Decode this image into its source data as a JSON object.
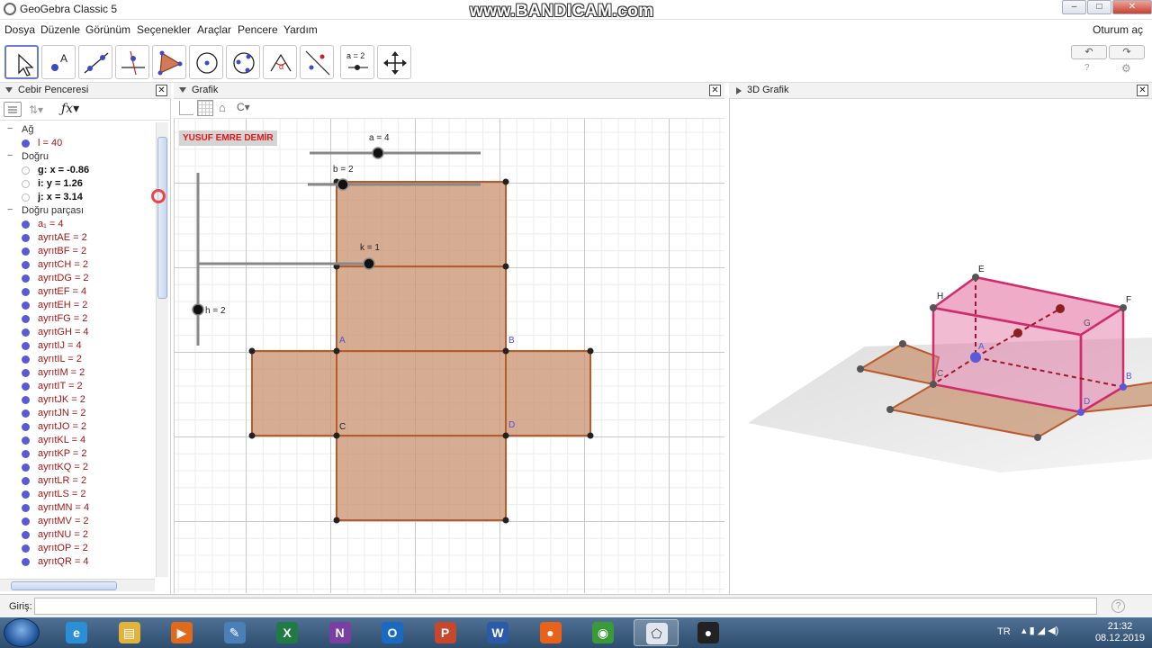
{
  "window": {
    "title": "GeoGebra Classic 5",
    "watermark": "www.BANDICAM.com",
    "buttons": {
      "minimize": "–",
      "maximize": "□",
      "close": "✕"
    }
  },
  "menu": {
    "items": [
      "Dosya",
      "Düzenle",
      "Görünüm",
      "Seçenekler",
      "Araçlar",
      "Pencere",
      "Yardım"
    ],
    "login": "Oturum aç"
  },
  "toolbar": {
    "tools": [
      {
        "name": "move-tool-icon"
      },
      {
        "name": "point-tool-icon"
      },
      {
        "name": "line-tool-icon"
      },
      {
        "name": "perpendicular-tool-icon"
      },
      {
        "name": "polygon-tool-icon"
      },
      {
        "name": "circle-tool-icon"
      },
      {
        "name": "ellipse-tool-icon"
      },
      {
        "name": "angle-tool-icon"
      },
      {
        "name": "reflect-tool-icon"
      },
      {
        "name": "slider-tool-icon",
        "label": "a = 2"
      },
      {
        "name": "move-view-tool-icon"
      }
    ],
    "undo": "↶",
    "redo": "↷",
    "help": "?",
    "settings": "⚙"
  },
  "algebra": {
    "title": "Cebir Penceresi",
    "categories": [
      {
        "label": "Ağ",
        "items": [
          {
            "text": "l = 40",
            "style": "red",
            "dot": "filled"
          }
        ]
      },
      {
        "label": "Doğru",
        "items": [
          {
            "text": "g: x = -0.86",
            "style": "blk",
            "dot": "hollow"
          },
          {
            "text": "i: y = 1.26",
            "style": "blk",
            "dot": "hollow"
          },
          {
            "text": "j: x = 3.14",
            "style": "blk",
            "dot": "hollow"
          }
        ]
      },
      {
        "label": "Doğru parçası",
        "items": [
          {
            "text": "a₁ = 4",
            "style": "red",
            "dot": "filled"
          },
          {
            "text": "ayrıtAE = 2",
            "style": "red",
            "dot": "filled"
          },
          {
            "text": "ayrıtBF = 2",
            "style": "red",
            "dot": "filled"
          },
          {
            "text": "ayrıtCH = 2",
            "style": "red",
            "dot": "filled"
          },
          {
            "text": "ayrıtDG = 2",
            "style": "red",
            "dot": "filled"
          },
          {
            "text": "ayrıtEF = 4",
            "style": "red",
            "dot": "filled"
          },
          {
            "text": "ayrıtEH = 2",
            "style": "red",
            "dot": "filled"
          },
          {
            "text": "ayrıtFG = 2",
            "style": "red",
            "dot": "filled"
          },
          {
            "text": "ayrıtGH = 4",
            "style": "red",
            "dot": "filled"
          },
          {
            "text": "ayrıtIJ = 4",
            "style": "red",
            "dot": "filled"
          },
          {
            "text": "ayrıtIL = 2",
            "style": "red",
            "dot": "filled"
          },
          {
            "text": "ayrıtIM = 2",
            "style": "red",
            "dot": "filled"
          },
          {
            "text": "ayrıtIT = 2",
            "style": "red",
            "dot": "filled"
          },
          {
            "text": "ayrıtJK = 2",
            "style": "red",
            "dot": "filled"
          },
          {
            "text": "ayrıtJN = 2",
            "style": "red",
            "dot": "filled"
          },
          {
            "text": "ayrıtJO = 2",
            "style": "red",
            "dot": "filled"
          },
          {
            "text": "ayrıtKL = 4",
            "style": "red",
            "dot": "filled"
          },
          {
            "text": "ayrıtKP = 2",
            "style": "red",
            "dot": "filled"
          },
          {
            "text": "ayrıtKQ = 2",
            "style": "red",
            "dot": "filled"
          },
          {
            "text": "ayrıtLR = 2",
            "style": "red",
            "dot": "filled"
          },
          {
            "text": "ayrıtLS = 2",
            "style": "red",
            "dot": "filled"
          },
          {
            "text": "ayrıtMN = 4",
            "style": "red",
            "dot": "filled"
          },
          {
            "text": "ayrıtMV = 2",
            "style": "red",
            "dot": "filled"
          },
          {
            "text": "ayrıtNU = 2",
            "style": "red",
            "dot": "filled"
          },
          {
            "text": "ayrıtOP = 2",
            "style": "red",
            "dot": "filled"
          },
          {
            "text": "ayrıtQR = 4",
            "style": "red",
            "dot": "filled"
          }
        ]
      }
    ]
  },
  "graphics": {
    "title": "Grafik",
    "author_label": "YUSUF EMRE DEMİR",
    "sliders": {
      "a": "a = 4",
      "b": "b = 2",
      "k": "k = 1",
      "h": "h = 2"
    },
    "points": {
      "A": "A",
      "B": "B",
      "C": "C",
      "D": "D"
    },
    "face_color": "#c8906e",
    "edge_color": "#b85a2a"
  },
  "view3d": {
    "title": "3D Grafik",
    "labels": {
      "E": "E",
      "F": "F",
      "H": "H",
      "G": "G",
      "A": "A",
      "B": "B",
      "C": "C",
      "D": "D"
    },
    "prism_color": "#e0689a",
    "net_color": "#c8906e"
  },
  "input": {
    "label": "Giriş:",
    "value": ""
  },
  "taskbar": {
    "apps": [
      {
        "name": "ie-icon",
        "glyph": "e",
        "color": "#2b8fd8"
      },
      {
        "name": "explorer-icon",
        "glyph": "▤",
        "color": "#e2b23a"
      },
      {
        "name": "media-player-icon",
        "glyph": "▶",
        "color": "#e06a1b"
      },
      {
        "name": "tools-icon",
        "glyph": "✎",
        "color": "#4a7fb8"
      },
      {
        "name": "excel-icon",
        "glyph": "X",
        "color": "#1f7a43"
      },
      {
        "name": "onenote-icon",
        "glyph": "N",
        "color": "#7a3fa0"
      },
      {
        "name": "outlook-icon",
        "glyph": "O",
        "color": "#1a6ac2"
      },
      {
        "name": "powerpoint-icon",
        "glyph": "P",
        "color": "#c8462a"
      },
      {
        "name": "word-icon",
        "glyph": "W",
        "color": "#2a5aa8"
      },
      {
        "name": "firefox-icon",
        "glyph": "●",
        "color": "#e8621a"
      },
      {
        "name": "chrome-icon",
        "glyph": "◉",
        "color": "#3a9a3a"
      },
      {
        "name": "geogebra-taskbar-icon",
        "glyph": "⬠",
        "color": "#dfe6ef"
      },
      {
        "name": "bandicam-icon",
        "glyph": "●",
        "color": "#222"
      }
    ],
    "lang": "TR",
    "time": "21:32",
    "date": "08.12.2019"
  }
}
